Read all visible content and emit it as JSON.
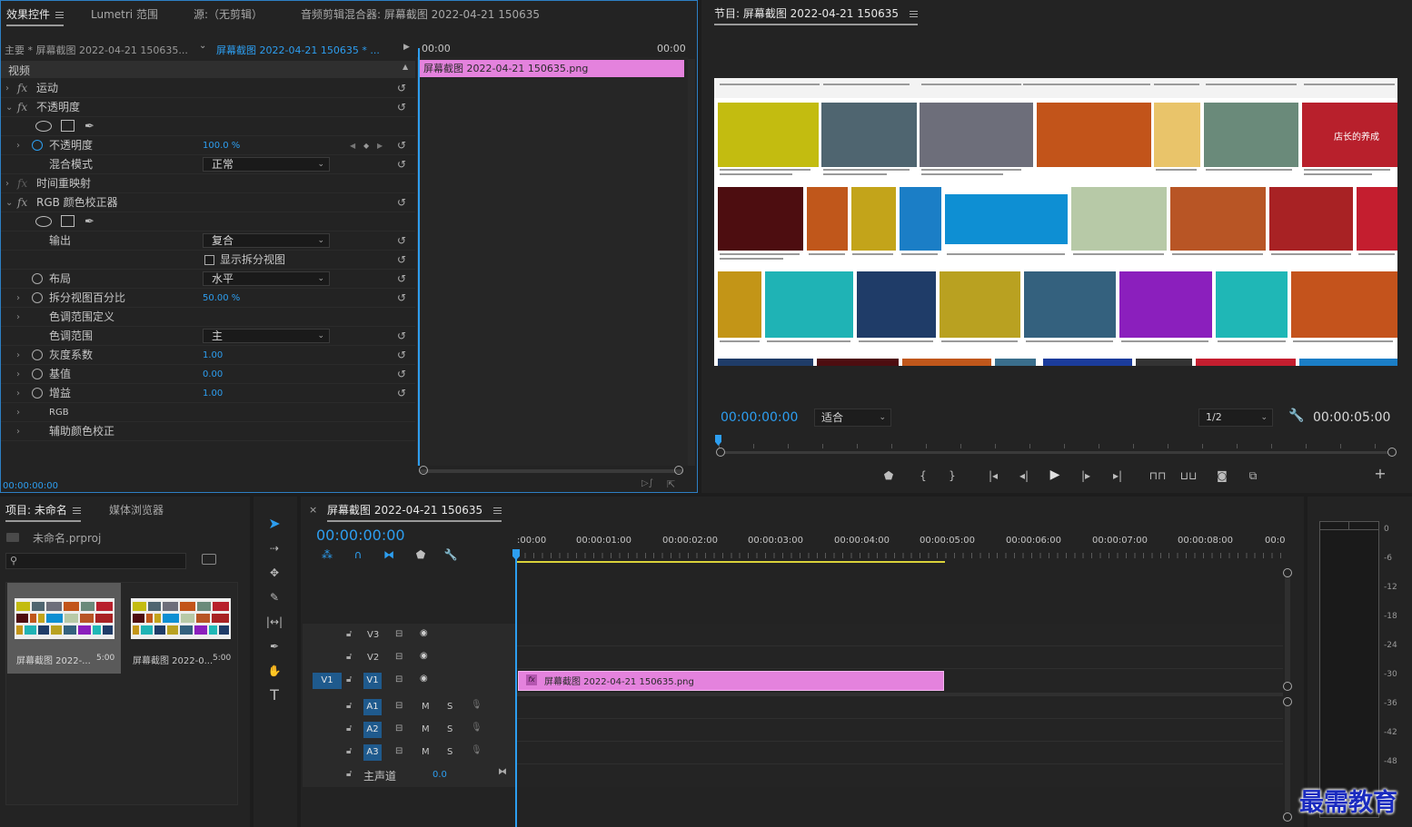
{
  "effect_controls": {
    "tabs": [
      "效果控件",
      "Lumetri 范围",
      "源:（无剪辑）",
      "音频剪辑混合器: 屏幕截图 2022-04-21 150635"
    ],
    "master_label": "主要 * 屏幕截图 2022-04-21 150635...",
    "clip_label": "屏幕截图 2022-04-21 150635 * ...",
    "ruler_start": "00:00",
    "ruler_end": "00:00",
    "section": "视频",
    "clip_bar": "屏幕截图 2022-04-21  150635.png",
    "rows": {
      "motion": "运动",
      "opacity_group": "不透明度",
      "opacity": "不透明度",
      "opacity_value": "100.0 %",
      "blend_mode": "混合模式",
      "blend_value": "正常",
      "time_remap": "时间重映射",
      "rgb_corrector": "RGB 颜色校正器",
      "output": "输出",
      "output_value": "复合",
      "split_view": "显示拆分视图",
      "layout": "布局",
      "layout_value": "水平",
      "split_percent": "拆分视图百分比",
      "split_percent_value": "50.00 %",
      "tonal_def": "色调范围定义",
      "tonal_range": "色调范围",
      "tonal_range_value": "主",
      "gamma": "灰度系数",
      "gamma_value": "1.00",
      "pedestal": "基值",
      "pedestal_value": "0.00",
      "gain": "增益",
      "gain_value": "1.00",
      "rgb": "RGB",
      "secondary": "辅助颜色校正"
    },
    "timecode": "00:00:00:00"
  },
  "program": {
    "title": "节目: 屏幕截图 2022-04-21 150635",
    "timecode": "00:00:00:00",
    "fit": "适合",
    "resolution": "1/2",
    "duration": "00:00:05:00",
    "image_label": "店长的养成"
  },
  "project": {
    "tabs": [
      "项目: 未命名",
      "媒体浏览器"
    ],
    "file": "未命名.prproj",
    "items": [
      {
        "name": "屏幕截图 2022-...",
        "dur": "5:00"
      },
      {
        "name": "屏幕截图 2022-0...",
        "dur": "5:00"
      }
    ]
  },
  "timeline": {
    "title": "屏幕截图 2022-04-21 150635",
    "timecode": "00:00:00:00",
    "ruler": [
      ":00:00",
      "00:00:01:00",
      "00:00:02:00",
      "00:00:03:00",
      "00:00:04:00",
      "00:00:05:00",
      "00:00:06:00",
      "00:00:07:00",
      "00:00:08:00",
      "00:0"
    ],
    "tracks_video": [
      "V3",
      "V2",
      "V1"
    ],
    "tracks_audio": [
      "A1",
      "A2",
      "A3"
    ],
    "source_patch": "V1",
    "master": "主声道",
    "master_value": "0.0",
    "clip": "屏幕截图 2022-04-21  150635.png",
    "m": "M",
    "s": "S"
  },
  "meter": {
    "scale": [
      "0",
      "-6",
      "-12",
      "-18",
      "-24",
      "-30",
      "-36",
      "-42",
      "-48"
    ]
  },
  "watermark": "最需教育",
  "colors": {
    "accent": "#2d9ef0",
    "clip": "#e482dd",
    "track_blue": "#1f5a8d"
  }
}
